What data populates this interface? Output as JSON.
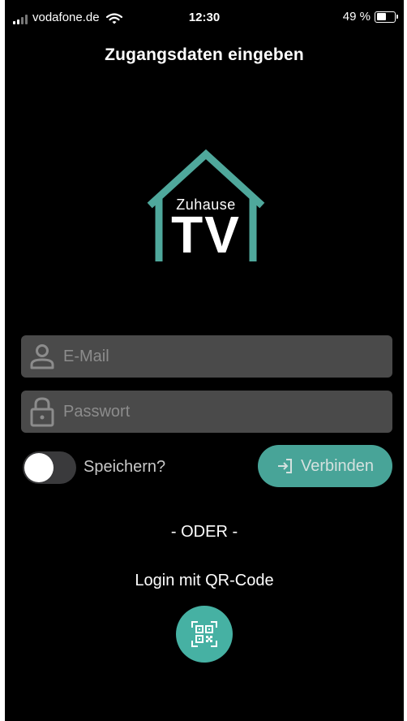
{
  "status_bar": {
    "carrier": "vodafone.de",
    "time": "12:30",
    "battery_text": "49 %",
    "battery_level": 0.49
  },
  "header": {
    "title": "Zugangsdaten eingeben"
  },
  "logo": {
    "word": "Zuhause",
    "mark": "TV"
  },
  "login_form": {
    "email": {
      "placeholder": "E-Mail",
      "value": "",
      "icon": "user-icon"
    },
    "password": {
      "placeholder": "Passwort",
      "value": "",
      "icon": "lock-icon"
    },
    "remember": {
      "label": "Speichern?",
      "checked": false
    },
    "connect": {
      "label": "Verbinden",
      "icon": "login-arrow-icon"
    }
  },
  "alternative": {
    "divider": "- ODER -",
    "qr_label": "Login mit QR-Code",
    "qr_icon": "qr-code-icon"
  },
  "colors": {
    "accent": "#4fb2a5",
    "background": "#000000",
    "input_background": "#4a4a4a",
    "logo_house": "#4fa89c"
  }
}
